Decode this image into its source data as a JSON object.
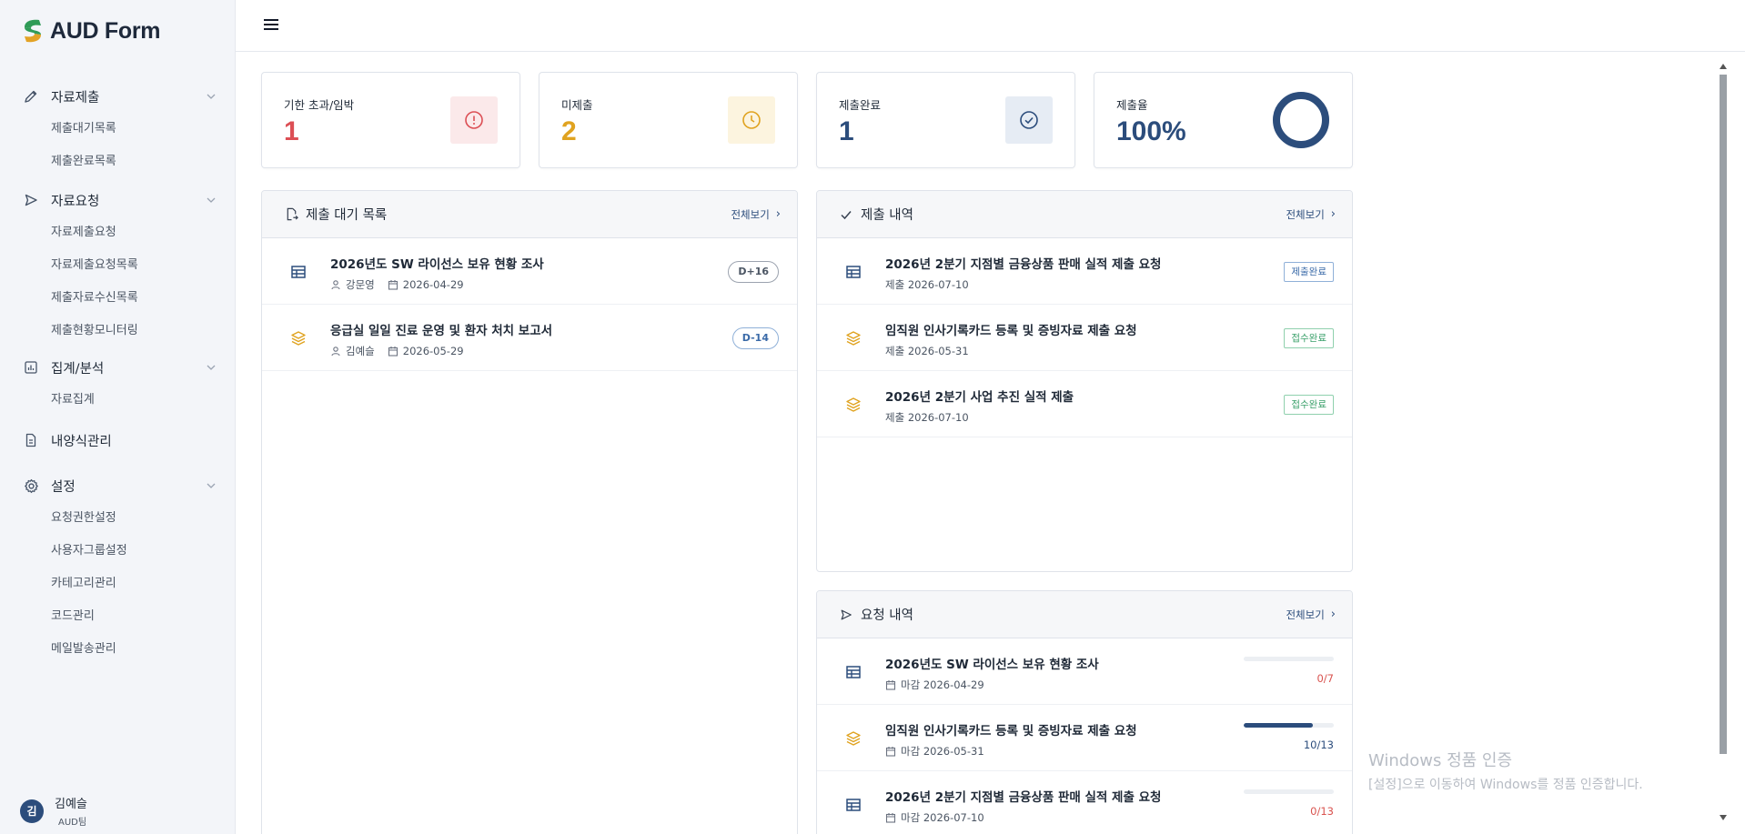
{
  "app": {
    "logo_text": "AUD Form"
  },
  "sidebar": {
    "groups": [
      {
        "label": "자료제출",
        "icon": "pencil-icon",
        "items": [
          "제출대기목록",
          "제출완료목록"
        ]
      },
      {
        "label": "자료요청",
        "icon": "send-icon",
        "items": [
          "자료제출요청",
          "자료제출요청목록",
          "제출자료수신목록",
          "제출현황모니터링"
        ]
      },
      {
        "label": "집계/분석",
        "icon": "chart-icon",
        "items": [
          "자료집계"
        ]
      },
      {
        "label": "내양식관리",
        "icon": "document-icon",
        "items": []
      },
      {
        "label": "설정",
        "icon": "gear-icon",
        "items": [
          "요청권한설정",
          "사용자그룹설정",
          "카테고리관리",
          "코드관리",
          "메일발송관리"
        ]
      }
    ],
    "user": {
      "initial": "김",
      "name": "김예슬",
      "team": "AUD팀"
    }
  },
  "stats": [
    {
      "title": "기한 초과/임박",
      "value": "1",
      "color": "#dc4f55",
      "icon": "alert-circle-icon"
    },
    {
      "title": "미제출",
      "value": "2",
      "color": "#e0a320",
      "icon": "clock-icon"
    },
    {
      "title": "제출완료",
      "value": "1",
      "color": "#2c4d7c",
      "icon": "check-circle-icon"
    },
    {
      "title": "제출율",
      "value": "100%",
      "color": "#2c4d7c",
      "icon": "donut-chart",
      "rate": 1.0
    }
  ],
  "pending": {
    "title": "제출 대기 목록",
    "more": "전체보기",
    "rows": [
      {
        "icon": "table-icon",
        "title": "2026년도 SW 라이선스 보유 현황 조사",
        "person": "강문영",
        "date": "2026-04-29",
        "badge": "D+16",
        "badge_color": "#6b7280"
      },
      {
        "icon": "layers-icon",
        "title": "응급실 일일 진료 운영 및 환자 처치 보고서",
        "person": "김예슬",
        "date": "2026-05-29",
        "badge": "D-14",
        "badge_color": "#3a6aa8"
      }
    ]
  },
  "submitted": {
    "title": "제출 내역",
    "more": "전체보기",
    "rows": [
      {
        "icon": "table-icon",
        "title": "2026년 2분기 지점별 금융상품 판매 실적 제출 요청",
        "meta": "제출 2026-07-10",
        "badge": "제출완료",
        "badge_color": "#3a6aa8"
      },
      {
        "icon": "layers-icon",
        "title": "임직원 인사기록카드 등록 및 증빙자료 제출 요청",
        "meta": "제출 2026-05-31",
        "badge": "접수완료",
        "badge_color": "#3aa06a"
      },
      {
        "icon": "layers-icon",
        "title": "2026년 2분기 사업 추진 실적 제출",
        "meta": "제출 2026-07-10",
        "badge": "접수완료",
        "badge_color": "#3aa06a"
      }
    ]
  },
  "requests": {
    "title": "요청 내역",
    "more": "전체보기",
    "rows": [
      {
        "icon": "table-icon",
        "title": "2026년도 SW 라이선스 보유 현황 조사",
        "meta": "마감 2026-04-29",
        "progress_text": "0/7",
        "progress": 0.0,
        "text_color": "#d9534f"
      },
      {
        "icon": "layers-icon",
        "title": "임직원 인사기록카드 등록 및 증빙자료 제출 요청",
        "meta": "마감 2026-05-31",
        "progress_text": "10/13",
        "progress": 0.77,
        "text_color": "#2c4d7c"
      },
      {
        "icon": "table-icon",
        "title": "2026년 2분기 지점별 금융상품 판매 실적 제출 요청",
        "meta": "마감 2026-07-10",
        "progress_text": "0/13",
        "progress": 0.0,
        "text_color": "#d9534f"
      }
    ]
  },
  "watermark": {
    "line1": "Windows 정품 인증",
    "line2": "[설정]으로 이동하여 Windows를 정품 인증합니다."
  }
}
